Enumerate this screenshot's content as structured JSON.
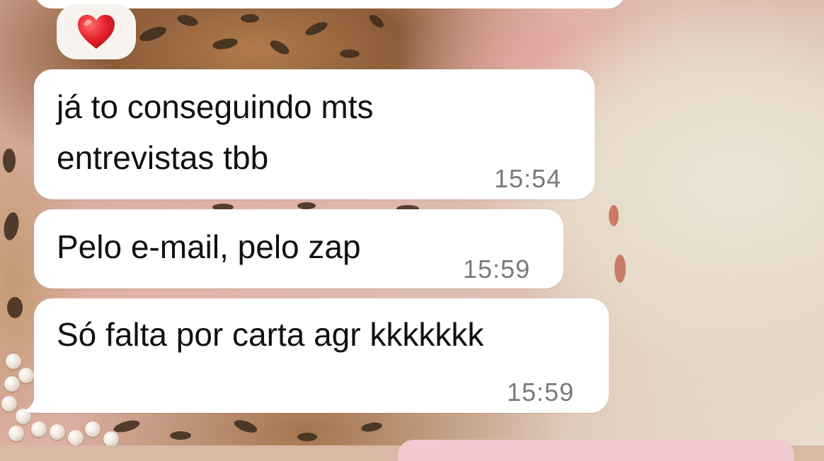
{
  "reaction": {
    "emoji": "❤️",
    "icon": "heart-icon"
  },
  "messages": [
    {
      "line1": "já to conseguindo mts",
      "line2": "entrevistas tbb",
      "time": "15:54"
    },
    {
      "text": "Pelo e-mail, pelo zap",
      "time": "15:59"
    },
    {
      "text": "Só falta por carta agr kkkkkkk",
      "time": "15:59"
    }
  ],
  "colors": {
    "bubble": "#ffffff",
    "time": "#7a7a7a",
    "reaction_bg": "#f7f3ee"
  }
}
